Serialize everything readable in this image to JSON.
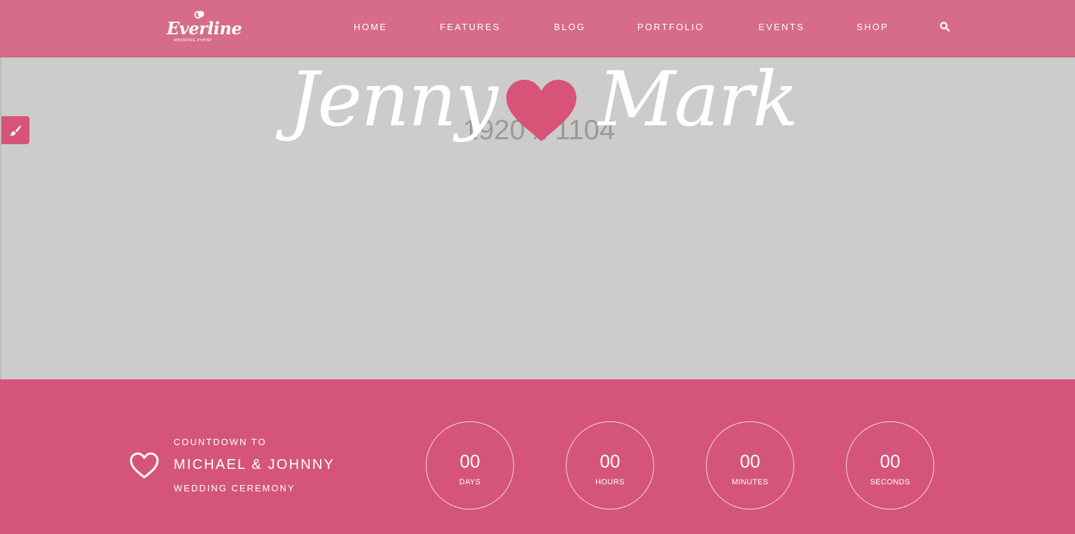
{
  "brand": {
    "name": "Everline",
    "tagline": "WEDDING EVENT",
    "color": "#d76b8a"
  },
  "nav": {
    "items": [
      {
        "label": "HOME"
      },
      {
        "label": "FEATURES"
      },
      {
        "label": "BLOG"
      },
      {
        "label": "PORTFOLIO"
      },
      {
        "label": "EVENTS"
      },
      {
        "label": "SHOP"
      }
    ],
    "search_icon": "search-icon"
  },
  "hero": {
    "placeholder_label": "1920 x 1104",
    "name_left": "Jenny",
    "name_right": "Mark",
    "heart_color": "#d75378",
    "side_toggle_icon": "paint-brush-icon"
  },
  "countdown": {
    "background": "#d5557a",
    "line1": "COUNTDOWN TO",
    "line2": "MICHAEL & JOHNNY",
    "line3": "WEDDING CEREMONY",
    "units": [
      {
        "value": "00",
        "label": "DAYS"
      },
      {
        "value": "00",
        "label": "HOURS"
      },
      {
        "value": "00",
        "label": "MINUTES"
      },
      {
        "value": "00",
        "label": "SECONDS"
      }
    ]
  }
}
